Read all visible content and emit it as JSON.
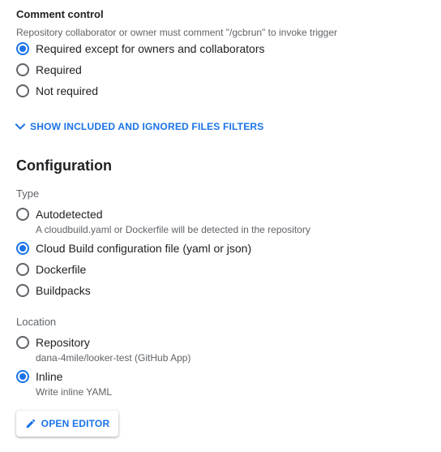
{
  "comment_control": {
    "title": "Comment control",
    "helper": "Repository collaborator or owner must comment \"/gcbrun\" to invoke trigger",
    "options": [
      {
        "label": "Required except for owners and collaborators",
        "checked": true
      },
      {
        "label": "Required",
        "checked": false
      },
      {
        "label": "Not required",
        "checked": false
      }
    ]
  },
  "filters_toggle": {
    "label": "SHOW INCLUDED AND IGNORED FILES FILTERS",
    "icon": "chevron-down-icon"
  },
  "configuration": {
    "heading": "Configuration",
    "type": {
      "label": "Type",
      "options": [
        {
          "label": "Autodetected",
          "sub": "A cloudbuild.yaml or Dockerfile will be detected in the repository",
          "checked": false
        },
        {
          "label": "Cloud Build configuration file (yaml or json)",
          "checked": true
        },
        {
          "label": "Dockerfile",
          "checked": false
        },
        {
          "label": "Buildpacks",
          "checked": false
        }
      ]
    },
    "location": {
      "label": "Location",
      "options": [
        {
          "label": "Repository",
          "sub": "dana-4mile/looker-test (GitHub App)",
          "checked": false
        },
        {
          "label": "Inline",
          "sub": "Write inline YAML",
          "checked": true
        }
      ]
    }
  },
  "open_editor": {
    "label": "OPEN EDITOR",
    "icon": "pencil-icon"
  },
  "colors": {
    "accent": "#1a73e8",
    "text": "#202124",
    "secondary_text": "#5f6368"
  }
}
